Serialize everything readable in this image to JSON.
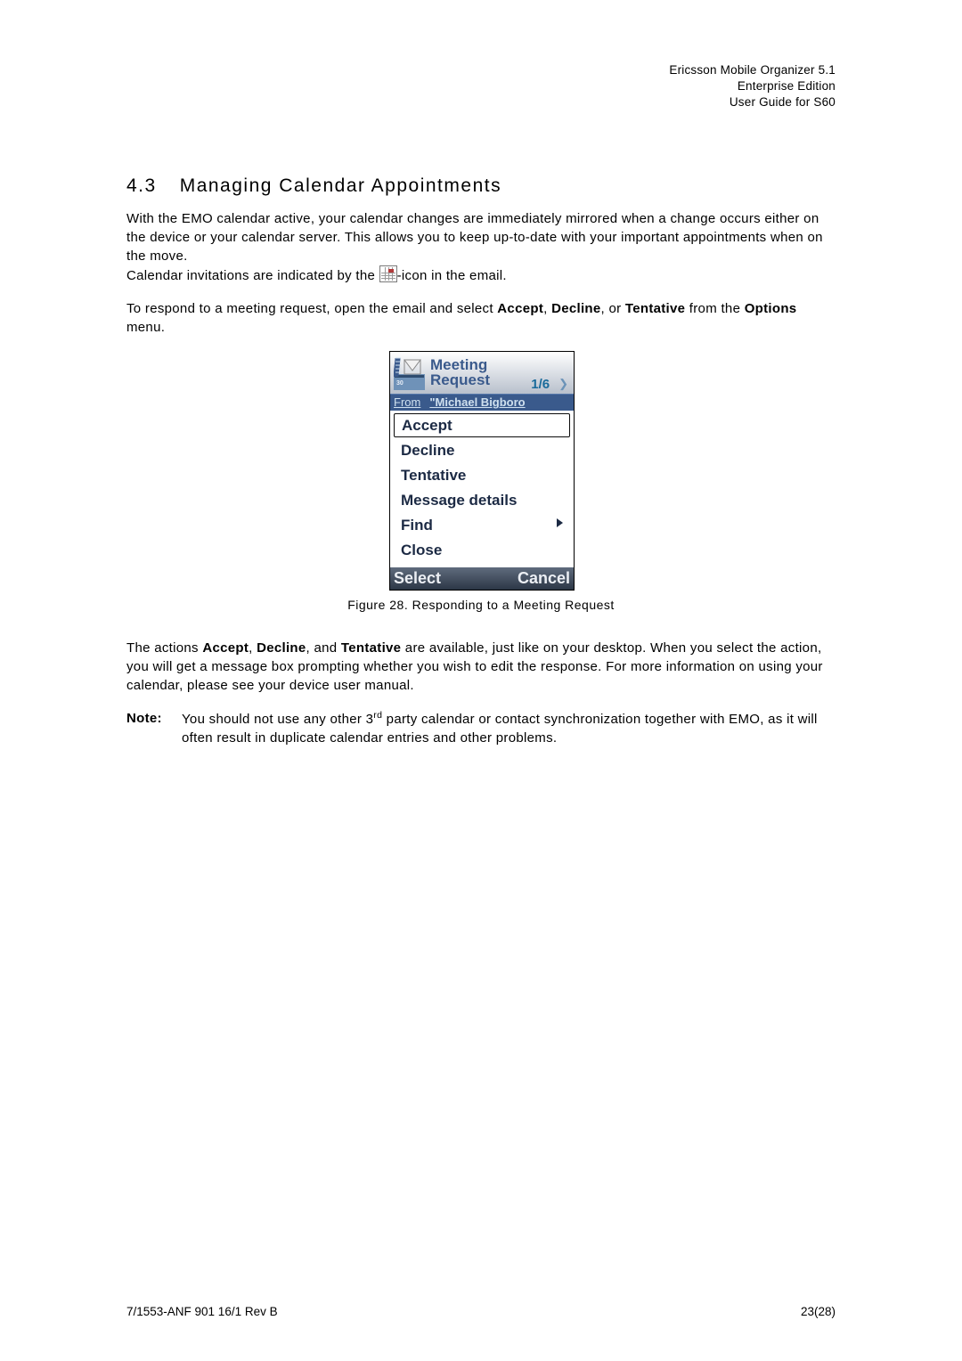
{
  "header": {
    "line1": "Ericsson Mobile Organizer 5.1",
    "line2": "Enterprise Edition",
    "line3": "User Guide for S60"
  },
  "section": {
    "number": "4.3",
    "title": "Managing Calendar Appointments"
  },
  "para1_a": "With the EMO calendar active, your calendar changes are immediately mirrored when a change occurs either on the device or your calendar server. This allows you to keep up-to-date with your important appointments when on the move.",
  "para1_b_prefix": "Calendar invitations are indicated by the ",
  "para1_b_suffix": "-icon in the email.",
  "para2_a": "To respond to a meeting request, open the email and select ",
  "para2_accept": "Accept",
  "para2_sep1": ", ",
  "para2_decline": "Decline",
  "para2_sep2": ", or ",
  "para2_tentative": "Tentative",
  "para2_b": " from the ",
  "para2_options": "Options",
  "para2_c": " menu.",
  "phone": {
    "title_line1": "Meeting",
    "title_line2": "Request",
    "counter": "1/6",
    "from_label": "From",
    "from_value": "\"Michael Bigboro",
    "menu": [
      "Accept",
      "Decline",
      "Tentative",
      "Message details",
      "Find",
      "Close"
    ],
    "soft_left": "Select",
    "soft_right": "Cancel"
  },
  "caption": "Figure 28. Responding to a Meeting Request",
  "para3_a": "The actions ",
  "para3_accept": "Accept",
  "para3_sep1": ", ",
  "para3_decline": "Decline",
  "para3_sep2": ", and ",
  "para3_tentative": "Tentative",
  "para3_b": " are available, just like on your desktop. When you select the action, you will get a message box prompting whether you wish to edit the response. For more information on using your calendar, please see your device user manual.",
  "note_label": "Note:",
  "note_body_a": "You should not use any other 3",
  "note_body_sup": "rd",
  "note_body_b": " party calendar or contact synchronization together with EMO, as it will often result in duplicate calendar entries and other problems.",
  "footer_left": "7/1553-ANF 901 16/1 Rev B",
  "footer_right": "23(28)"
}
